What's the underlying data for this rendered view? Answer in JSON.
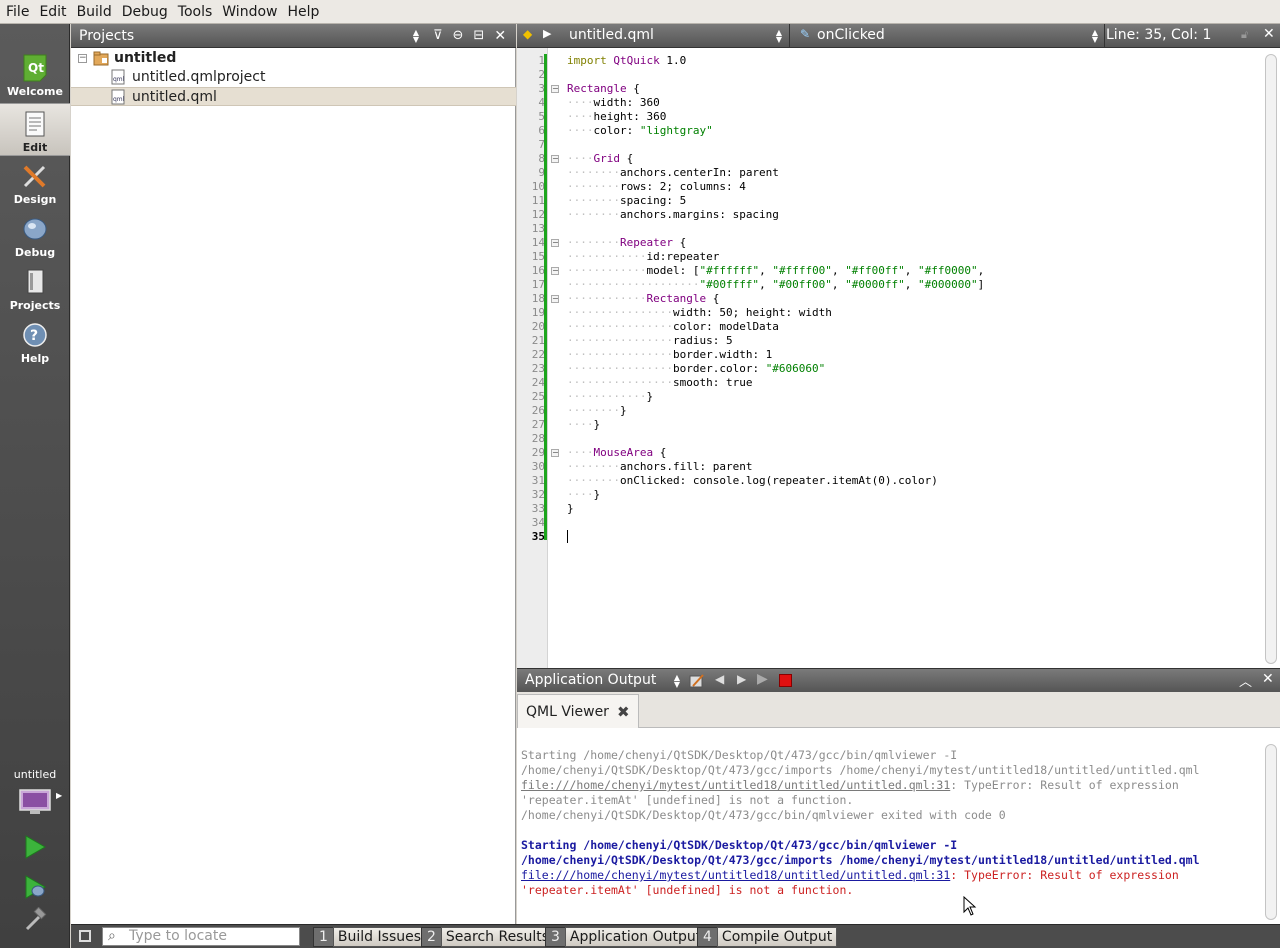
{
  "menu": [
    "File",
    "Edit",
    "Build",
    "Debug",
    "Tools",
    "Window",
    "Help"
  ],
  "modes": [
    {
      "label": "Welcome",
      "active": false
    },
    {
      "label": "Edit",
      "active": true
    },
    {
      "label": "Design",
      "active": false
    },
    {
      "label": "Debug",
      "active": false
    },
    {
      "label": "Projects",
      "active": false
    },
    {
      "label": "Help",
      "active": false
    }
  ],
  "target": {
    "label": "untitled"
  },
  "projects": {
    "title": "Projects",
    "tree": [
      {
        "label": "untitled",
        "level": 0,
        "bold": true
      },
      {
        "label": "untitled.qmlproject",
        "level": 1,
        "bold": false
      },
      {
        "label": "untitled.qml",
        "level": 1,
        "bold": false,
        "selected": true
      }
    ]
  },
  "editor": {
    "file": "untitled.qml",
    "symbol": "onClicked",
    "position": "Line: 35, Col: 1",
    "current_line": 35,
    "lines": [
      "import QtQuick 1.0",
      "",
      "Rectangle {",
      "    width: 360",
      "    height: 360",
      "    color: \"lightgray\"",
      "",
      "    Grid {",
      "        anchors.centerIn: parent",
      "        rows: 2; columns: 4",
      "        spacing: 5",
      "        anchors.margins: spacing",
      "",
      "        Repeater {",
      "            id:repeater",
      "            model: [\"#ffffff\", \"#ffff00\", \"#ff00ff\", \"#ff0000\",",
      "                    \"#00ffff\", \"#00ff00\", \"#0000ff\", \"#000000\"]",
      "            Rectangle {",
      "                width: 50; height: width",
      "                color: modelData",
      "                radius: 5",
      "                border.width: 1",
      "                border.color: \"#606060\"",
      "                smooth: true",
      "            }",
      "        }",
      "    }",
      "",
      "    MouseArea {",
      "        anchors.fill: parent",
      "        onClicked: console.log(repeater.itemAt(0).color)",
      "    }",
      "}",
      "",
      ""
    ],
    "fold_lines": [
      3,
      8,
      14,
      16,
      18,
      29
    ]
  },
  "output": {
    "title": "Application Output",
    "tab": "QML Viewer",
    "lines": [
      {
        "text": "Starting /home/chenyi/QtSDK/Desktop/Qt/473/gcc/bin/qmlviewer -I",
        "cls": "gray"
      },
      {
        "text": "/home/chenyi/QtSDK/Desktop/Qt/473/gcc/imports /home/chenyi/mytest/untitled18/untitled/untitled.qml",
        "cls": "gray"
      },
      {
        "link": "file:///home/chenyi/mytest/untitled18/untitled/untitled.qml:31",
        "text": ": TypeError: Result of expression",
        "cls": "gray"
      },
      {
        "text": "'repeater.itemAt' [undefined] is not a function.",
        "cls": "gray"
      },
      {
        "text": "/home/chenyi/QtSDK/Desktop/Qt/473/gcc/bin/qmlviewer exited with code 0",
        "cls": "gray"
      },
      {
        "text": "",
        "cls": "gray"
      },
      {
        "text": "Starting /home/chenyi/QtSDK/Desktop/Qt/473/gcc/bin/qmlviewer -I",
        "cls": "blue"
      },
      {
        "text": "/home/chenyi/QtSDK/Desktop/Qt/473/gcc/imports /home/chenyi/mytest/untitled18/untitled/untitled.qml",
        "cls": "blue"
      },
      {
        "link": "file:///home/chenyi/mytest/untitled18/untitled/untitled.qml:31",
        "text": ": TypeError: Result of expression",
        "cls": "red"
      },
      {
        "text": "'repeater.itemAt' [undefined] is not a function.",
        "cls": "red"
      }
    ]
  },
  "statusbar": {
    "locate_placeholder": "Type to locate",
    "buttons": [
      {
        "num": "1",
        "label": "Build Issues"
      },
      {
        "num": "2",
        "label": "Search Results"
      },
      {
        "num": "3",
        "label": "Application Output"
      },
      {
        "num": "4",
        "label": "Compile Output"
      }
    ]
  }
}
